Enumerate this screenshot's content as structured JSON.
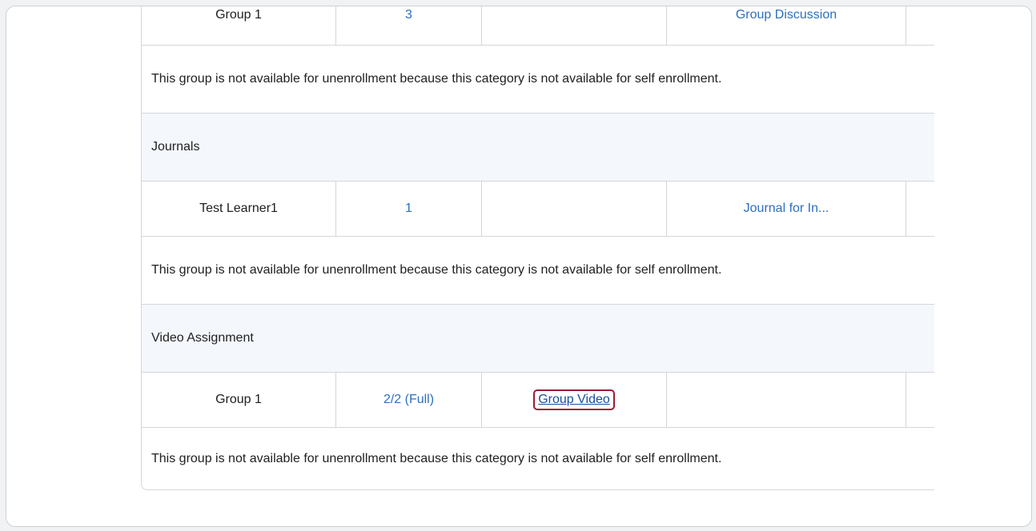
{
  "rows_top": {
    "col1": "Group 1",
    "col2": "3",
    "col4": "Group Discussion"
  },
  "notice": "This group is not available for unenrollment because this category is not available for self enrollment.",
  "categories": [
    {
      "name": "Journals",
      "group": {
        "name": "Test Learner1",
        "members": "1",
        "locker": "",
        "journal": "Journal for In..."
      }
    },
    {
      "name": "Video Assignment",
      "group": {
        "name": "Group 1",
        "members": "2/2 (Full)",
        "video_link": "Group Video",
        "journal": ""
      }
    }
  ],
  "colors": {
    "link": "#2e6fbf",
    "highlight_border": "#9b1b38",
    "category_bg": "#f4f7fc"
  }
}
